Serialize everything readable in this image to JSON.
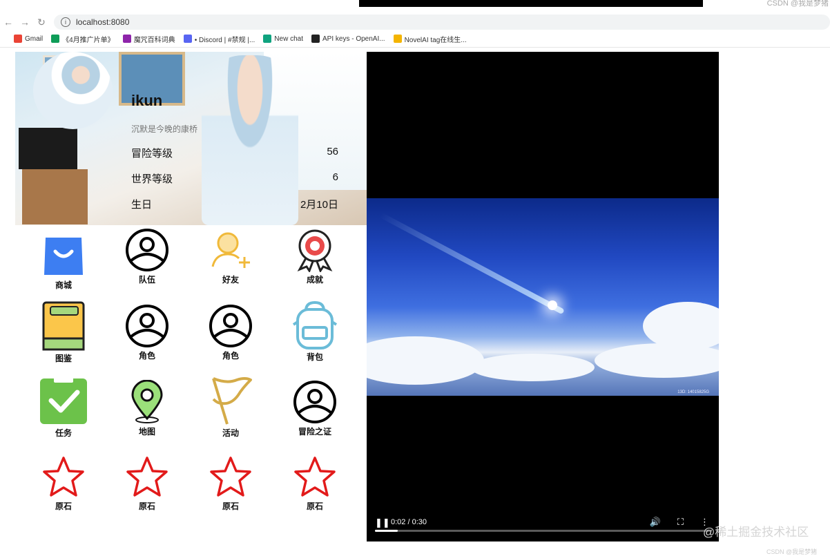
{
  "browser": {
    "url": "localhost:8080",
    "corner_text": "CSDN @我是梦猪",
    "bookmarks": [
      {
        "label": "Gmail",
        "color": "#ea4335"
      },
      {
        "label": "《4月推广片单》",
        "color": "#0f9d58"
      },
      {
        "label": "魔咒百科词典",
        "color": "#8e24aa"
      },
      {
        "label": "• Discord | #禁规 |...",
        "color": "#5865f2"
      },
      {
        "label": "New chat",
        "color": "#10a37f"
      },
      {
        "label": "API keys - OpenAI...",
        "color": "#222222"
      },
      {
        "label": "NovelAI tag在线生...",
        "color": "#f4b400"
      }
    ]
  },
  "profile": {
    "username": "ikun",
    "signature": "沉默是今晚的康桥",
    "stats": [
      {
        "label": "冒险等级",
        "value": "56"
      },
      {
        "label": "世界等级",
        "value": "6"
      },
      {
        "label": "生日",
        "value": "2月10日"
      }
    ]
  },
  "grid": {
    "items": [
      {
        "label": "商城",
        "icon": "shop-bag-icon"
      },
      {
        "label": "队伍",
        "icon": "user-circle-icon"
      },
      {
        "label": "好友",
        "icon": "add-friend-icon"
      },
      {
        "label": "成就",
        "icon": "medal-icon"
      },
      {
        "label": "图鉴",
        "icon": "book-icon"
      },
      {
        "label": "角色",
        "icon": "user-circle-icon"
      },
      {
        "label": "角色",
        "icon": "user-circle-icon"
      },
      {
        "label": "背包",
        "icon": "backpack-icon"
      },
      {
        "label": "任务",
        "icon": "task-check-icon"
      },
      {
        "label": "地图",
        "icon": "map-pin-icon"
      },
      {
        "label": "活动",
        "icon": "flag-icon"
      },
      {
        "label": "冒险之证",
        "icon": "user-circle-icon"
      },
      {
        "label": "原石",
        "icon": "star-icon"
      },
      {
        "label": "原石",
        "icon": "star-icon"
      },
      {
        "label": "原石",
        "icon": "star-icon"
      },
      {
        "label": "原石",
        "icon": "star-icon"
      }
    ]
  },
  "video": {
    "time": "0:02 / 0:30",
    "progress": 0.067,
    "frame_caption": "13D: 14015825G"
  },
  "watermark": "@稀土掘金技术社区",
  "footer_corner": "CSDN @我是梦猪"
}
